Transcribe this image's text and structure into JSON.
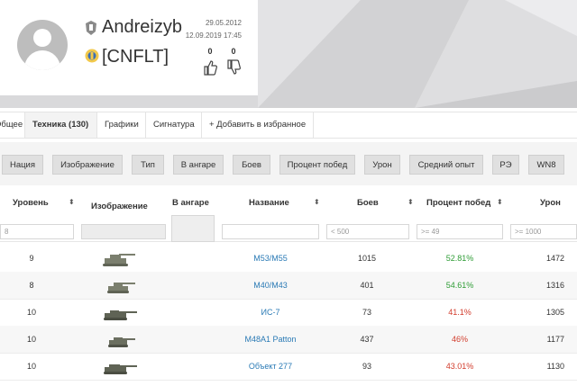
{
  "profile": {
    "player_name": "Andreizyb",
    "clan_tag": "[CNFLT]",
    "registered_date": "29.05.2012",
    "last_battle": "12.09.2019 17:45",
    "likes": "0",
    "dislikes": "0"
  },
  "tabs": [
    {
      "label": "Общее"
    },
    {
      "label": "Техника (130)"
    },
    {
      "label": "Графики"
    },
    {
      "label": "Сигнатура"
    },
    {
      "label": "+ Добавить в избранное"
    }
  ],
  "filters": [
    {
      "label": "Нация"
    },
    {
      "label": "Изображение"
    },
    {
      "label": "Тип"
    },
    {
      "label": "В ангаре"
    },
    {
      "label": "Боев"
    },
    {
      "label": "Процент побед"
    },
    {
      "label": "Урон"
    },
    {
      "label": "Средний опыт"
    },
    {
      "label": "РЭ"
    },
    {
      "label": "WN8"
    }
  ],
  "table": {
    "columns": {
      "level": "Уровень",
      "image": "Изображение",
      "hangar": "В ангаре",
      "name": "Название",
      "battles": "Боев",
      "winrate": "Процент побед",
      "damage": "Урон"
    },
    "filter_inputs": {
      "level": "8",
      "battles": "< 500",
      "winrate": ">= 49",
      "damage": ">= 1000"
    },
    "rows": [
      {
        "level": "9",
        "name": "M53/M55",
        "battles": "1015",
        "winrate": "52.81%",
        "winrate_color": "#2e9c35",
        "damage": "1472"
      },
      {
        "level": "8",
        "name": "M40/M43",
        "battles": "401",
        "winrate": "54.61%",
        "winrate_color": "#2e9c35",
        "damage": "1316"
      },
      {
        "level": "10",
        "name": "ИС-7",
        "battles": "73",
        "winrate": "41.1%",
        "winrate_color": "#d23c2c",
        "damage": "1305"
      },
      {
        "level": "10",
        "name": "M48A1 Patton",
        "battles": "437",
        "winrate": "46%",
        "winrate_color": "#d23c2c",
        "damage": "1177"
      },
      {
        "level": "10",
        "name": "Объект 277",
        "battles": "93",
        "winrate": "43.01%",
        "winrate_color": "#d23c2c",
        "damage": "1130"
      }
    ]
  },
  "colors": {
    "link": "#2a7ab5",
    "winrate_good": "#2e9c35",
    "winrate_bad": "#d23c2c",
    "tank_silhouette": "#7b7f6e"
  }
}
